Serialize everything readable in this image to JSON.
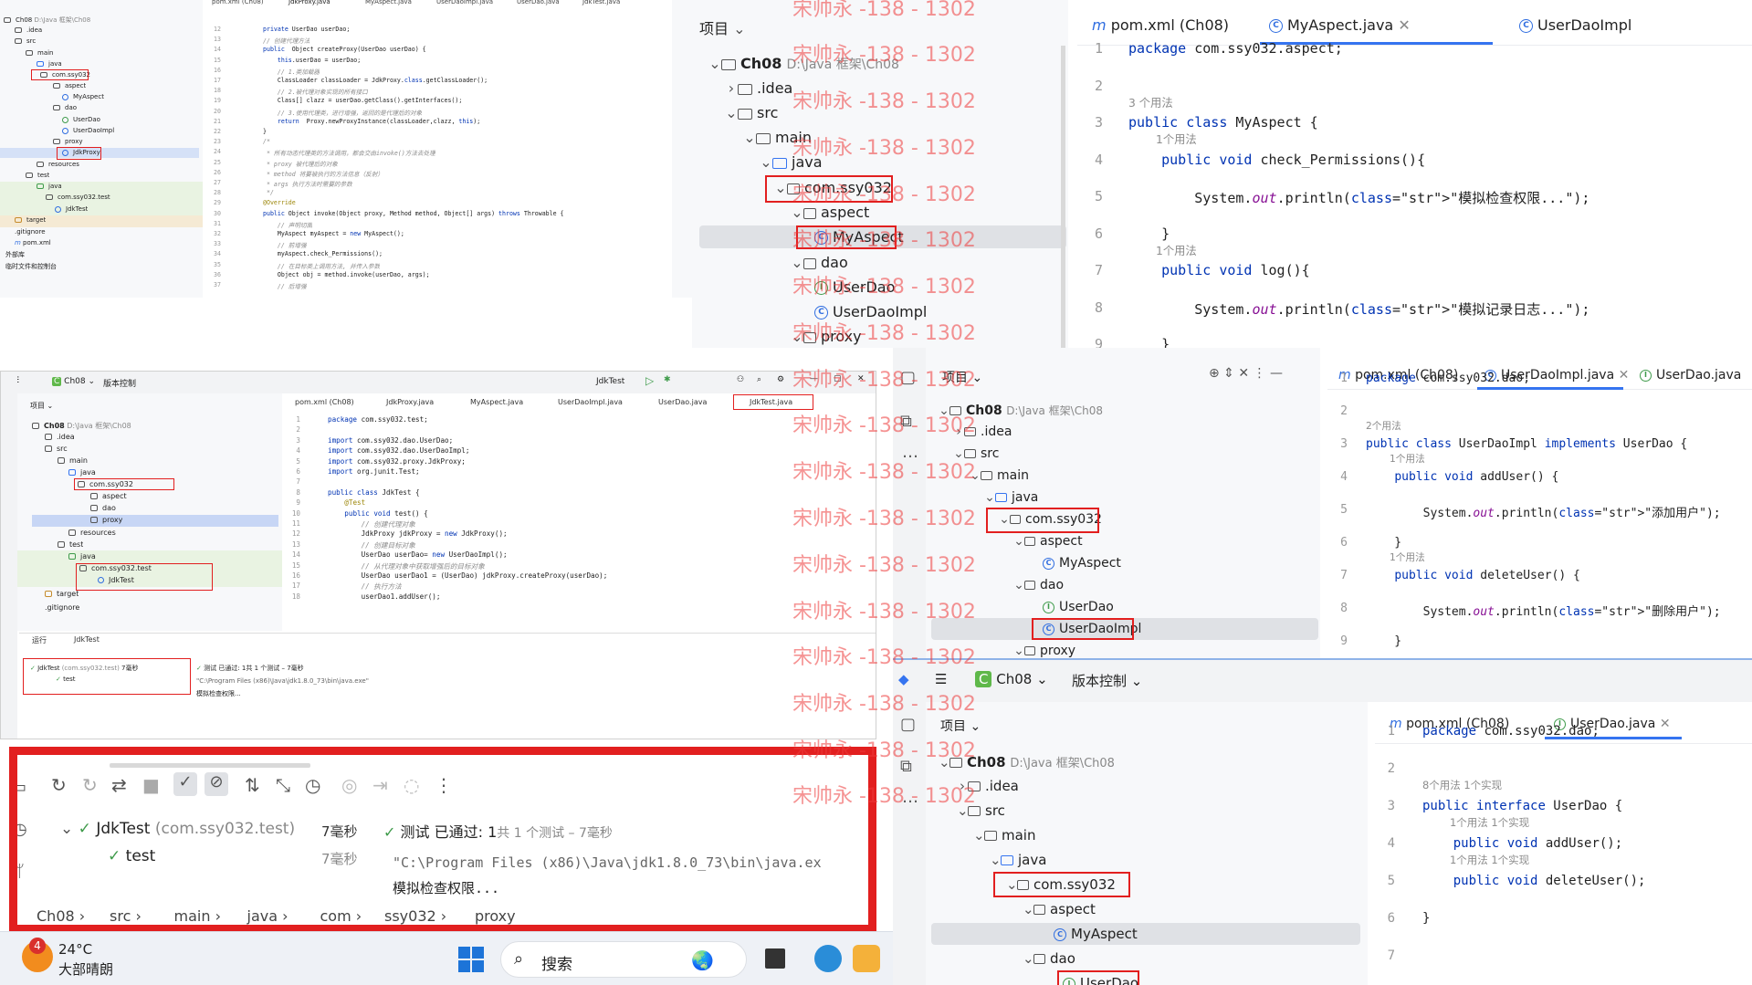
{
  "project": {
    "root": "Ch08",
    "root_path": "D:\\Java 框架\\Ch08",
    "idea": ".idea",
    "src": "src",
    "main": "main",
    "java": "java",
    "pkg": "com.ssy032",
    "aspect": "aspect",
    "myaspect": "MyAspect",
    "dao": "dao",
    "userdao": "UserDao",
    "userdaoimpl": "UserDaoImpl",
    "proxy": "proxy",
    "jdkproxy": "JdkProxy",
    "resources": "resources",
    "test": "test",
    "testpkg": "com.ssy032.test",
    "jdktest": "JdkTest",
    "target": "target",
    "gitignore": ".gitignore",
    "pomxml": "pom.xml",
    "external": "外部库",
    "scratches": "临时文件和控制台",
    "header": "项目"
  },
  "tabs": {
    "pom": "pom.xml (Ch08)",
    "jdkproxy": "JdkProxy.java",
    "myaspect": "MyAspect.java",
    "userdaoimpl": "UserDaoImpl.java",
    "userdao": "UserDao.java",
    "jdktest": "JdkTest.java",
    "userdaoimpl_trunc": "UserDaoImpl",
    "userdao_trunc": "UserDao.java"
  },
  "toolbar": {
    "project": "Ch08",
    "vcs": "版本控制",
    "run_config": "JdkTest"
  },
  "usage": {
    "u1": "1个用法",
    "u2": "2个用法",
    "u3": "3 个用法",
    "u8": "8个用法",
    "impl": "1个实现",
    "u1b": "1 个用法"
  },
  "code_myaspect": [
    "package com.ssy032.aspect;",
    "",
    "public class MyAspect {",
    "    public void check_Permissions(){",
    "        System.out.println(\"模拟检查权限...\");",
    "    }",
    "    public void log(){",
    "        System.out.println(\"模拟记录日志...\");",
    "    }",
    "}"
  ],
  "code_impl": [
    "package com.ssy032.dao;",
    "",
    "public class UserDaoImpl implements UserDao {",
    "    public void addUser() {",
    "        System.out.println(\"添加用户\");",
    "    }",
    "    public void deleteUser() {",
    "        System.out.println(\"删除用户\");",
    "    }",
    "}"
  ],
  "code_userdao": [
    "package com.ssy032.dao;",
    "",
    "public interface UserDao {",
    "    public void addUser();",
    "    public void deleteUser();",
    "}",
    ""
  ],
  "code_proxy": [
    "private UserDao userDao;",
    "// 创建代理方法",
    "public  Object createProxy(UserDao userDao) {",
    "    this.userDao = userDao;",
    "    // 1.类加载器",
    "    ClassLoader classLoader = JdkProxy.class.getClassLoader();",
    "    // 2.被代理对象实现的所有接口",
    "    Class[] clazz = userDao.getClass().getInterfaces();",
    "    // 3.使用代理类，进行增强，返回的是代理后的对象",
    "    return  Proxy.newProxyInstance(classLoader,clazz, this);",
    "}",
    "/*",
    " * 所有动态代理类的方法调用，都会交由invoke()方法去处理",
    " * proxy 被代理后的对象",
    " * method 将要被执行的方法信息（反射）",
    " * args 执行方法时需要的参数",
    " */",
    "@Override",
    "public Object invoke(Object proxy, Method method, Object[] args) throws Throwable {",
    "    // 声明切面",
    "    MyAspect myAspect = new MyAspect();",
    "    // 前增强",
    "    myAspect.check_Permissions();",
    "    // 在目标类上调用方法, 并传入参数",
    "    Object obj = method.invoke(userDao, args);",
    "    // 后增强"
  ],
  "code_test": [
    "package com.ssy032.test;",
    "",
    "import com.ssy032.dao.UserDao;",
    "import com.ssy032.dao.UserDaoImpl;",
    "import com.ssy032.proxy.JdkProxy;",
    "import org.junit.Test;",
    "",
    "public class JdkTest {",
    "    @Test",
    "    public void test() {",
    "        // 创建代理对象",
    "        JdkProxy jdkProxy = new JdkProxy();",
    "        // 创建目标对象",
    "        UserDao userDao= new UserDaoImpl();",
    "        // 从代理对象中获取增强后的目标对象",
    "        UserDao userDao1 = (UserDao) jdkProxy.createProxy(userDao);",
    "        // 执行方法",
    "        userDao1.addUser();"
  ],
  "run": {
    "tab_label": "运行",
    "tab_name": "JdkTest",
    "test_class": "JdkTest",
    "test_pkg": "(com.ssy032.test)",
    "test_time": "7毫秒",
    "test_method": "test",
    "method_time": "7毫秒",
    "status_pre": "测试 已通过: ",
    "status_count": "1",
    "status_suffix": "共 1 个测试 – 7毫秒",
    "cmd": "\"C:\\Program Files (x86)\\Java\\jdk1.8.0_73\\bin\\java.exe\"",
    "cmd_trunc": "\"C:\\Program Files (x86)\\Java\\jdk1.8.0_73\\bin\\java.ex",
    "output": "模拟检查权限...",
    "small_status": "测试 已通过: 1共 1 个测试 – 7毫秒"
  },
  "breadcrumb": [
    "Ch08",
    "src",
    "main",
    "java",
    "com",
    "ssy032",
    "proxy"
  ],
  "taskbar": {
    "temp": "24°C",
    "weather": "大部晴朗",
    "badge": "4",
    "search": "搜索"
  },
  "watermark": "宋帅永 -138 - 1302",
  "colors": {
    "red": "#e21f1f",
    "accent": "#3574f0",
    "green": "#3f9b4b"
  }
}
